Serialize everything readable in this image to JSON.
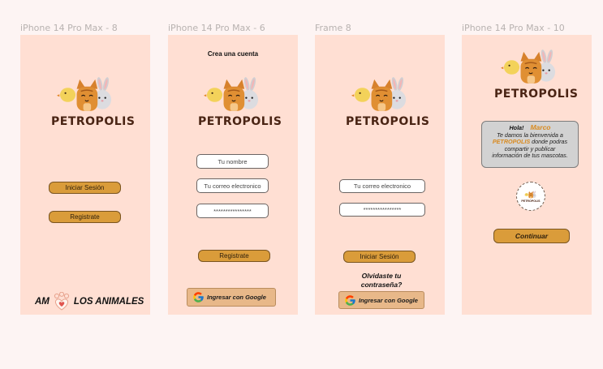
{
  "frames": [
    {
      "label": "iPhone 14 Pro Max - 8",
      "logo_text": "PETROPOLIS",
      "login_button": "Iniciar Sesión",
      "register_button": "Registrate",
      "slogan_left": "AM",
      "slogan_right": "LOS ANIMALES"
    },
    {
      "label": "iPhone 14 Pro Max - 6",
      "heading": "Crea una cuenta",
      "logo_text": "PETROPOLIS",
      "name_placeholder": "Tu nombre",
      "email_placeholder": "Tu correo electronico",
      "password_value": "****************",
      "register_button": "Registrate",
      "google_button": "Ingresar con Google"
    },
    {
      "label": "Frame 8",
      "logo_text": "PETROPOLIS",
      "email_placeholder": "Tu correo electronico",
      "password_value": "****************",
      "login_button": "Iniciar Sesión",
      "forgot_line1": "Olvidaste tu",
      "forgot_line2": "contraseña?",
      "google_button": "Ingresar con Google"
    },
    {
      "label": "iPhone 14 Pro Max - 10",
      "logo_text": "PETROPOLIS",
      "greeting": "Hola!",
      "user_name": "Marco",
      "welcome_line1": "Te damos la bienvenida a",
      "brand_word": "PETROPOLIS",
      "welcome_line2_rest": " donde podras",
      "welcome_line3": "compartir y publicar",
      "welcome_line4": "información de tus mascotas.",
      "badge_text": "PETROPOLIS",
      "continue_button": "Continuar"
    }
  ],
  "colors": {
    "frame_bg": "#ffdfd3",
    "canvas_bg": "#fdf4f3",
    "button_gold": "#da9c3a",
    "google_button_bg": "#e8b889",
    "brand_orange": "#d98a1f",
    "logo_text_dark": "#4a2414"
  },
  "icons": [
    "petropolis-logo",
    "google-icon",
    "heart-paw-icon",
    "petropolis-badge"
  ]
}
